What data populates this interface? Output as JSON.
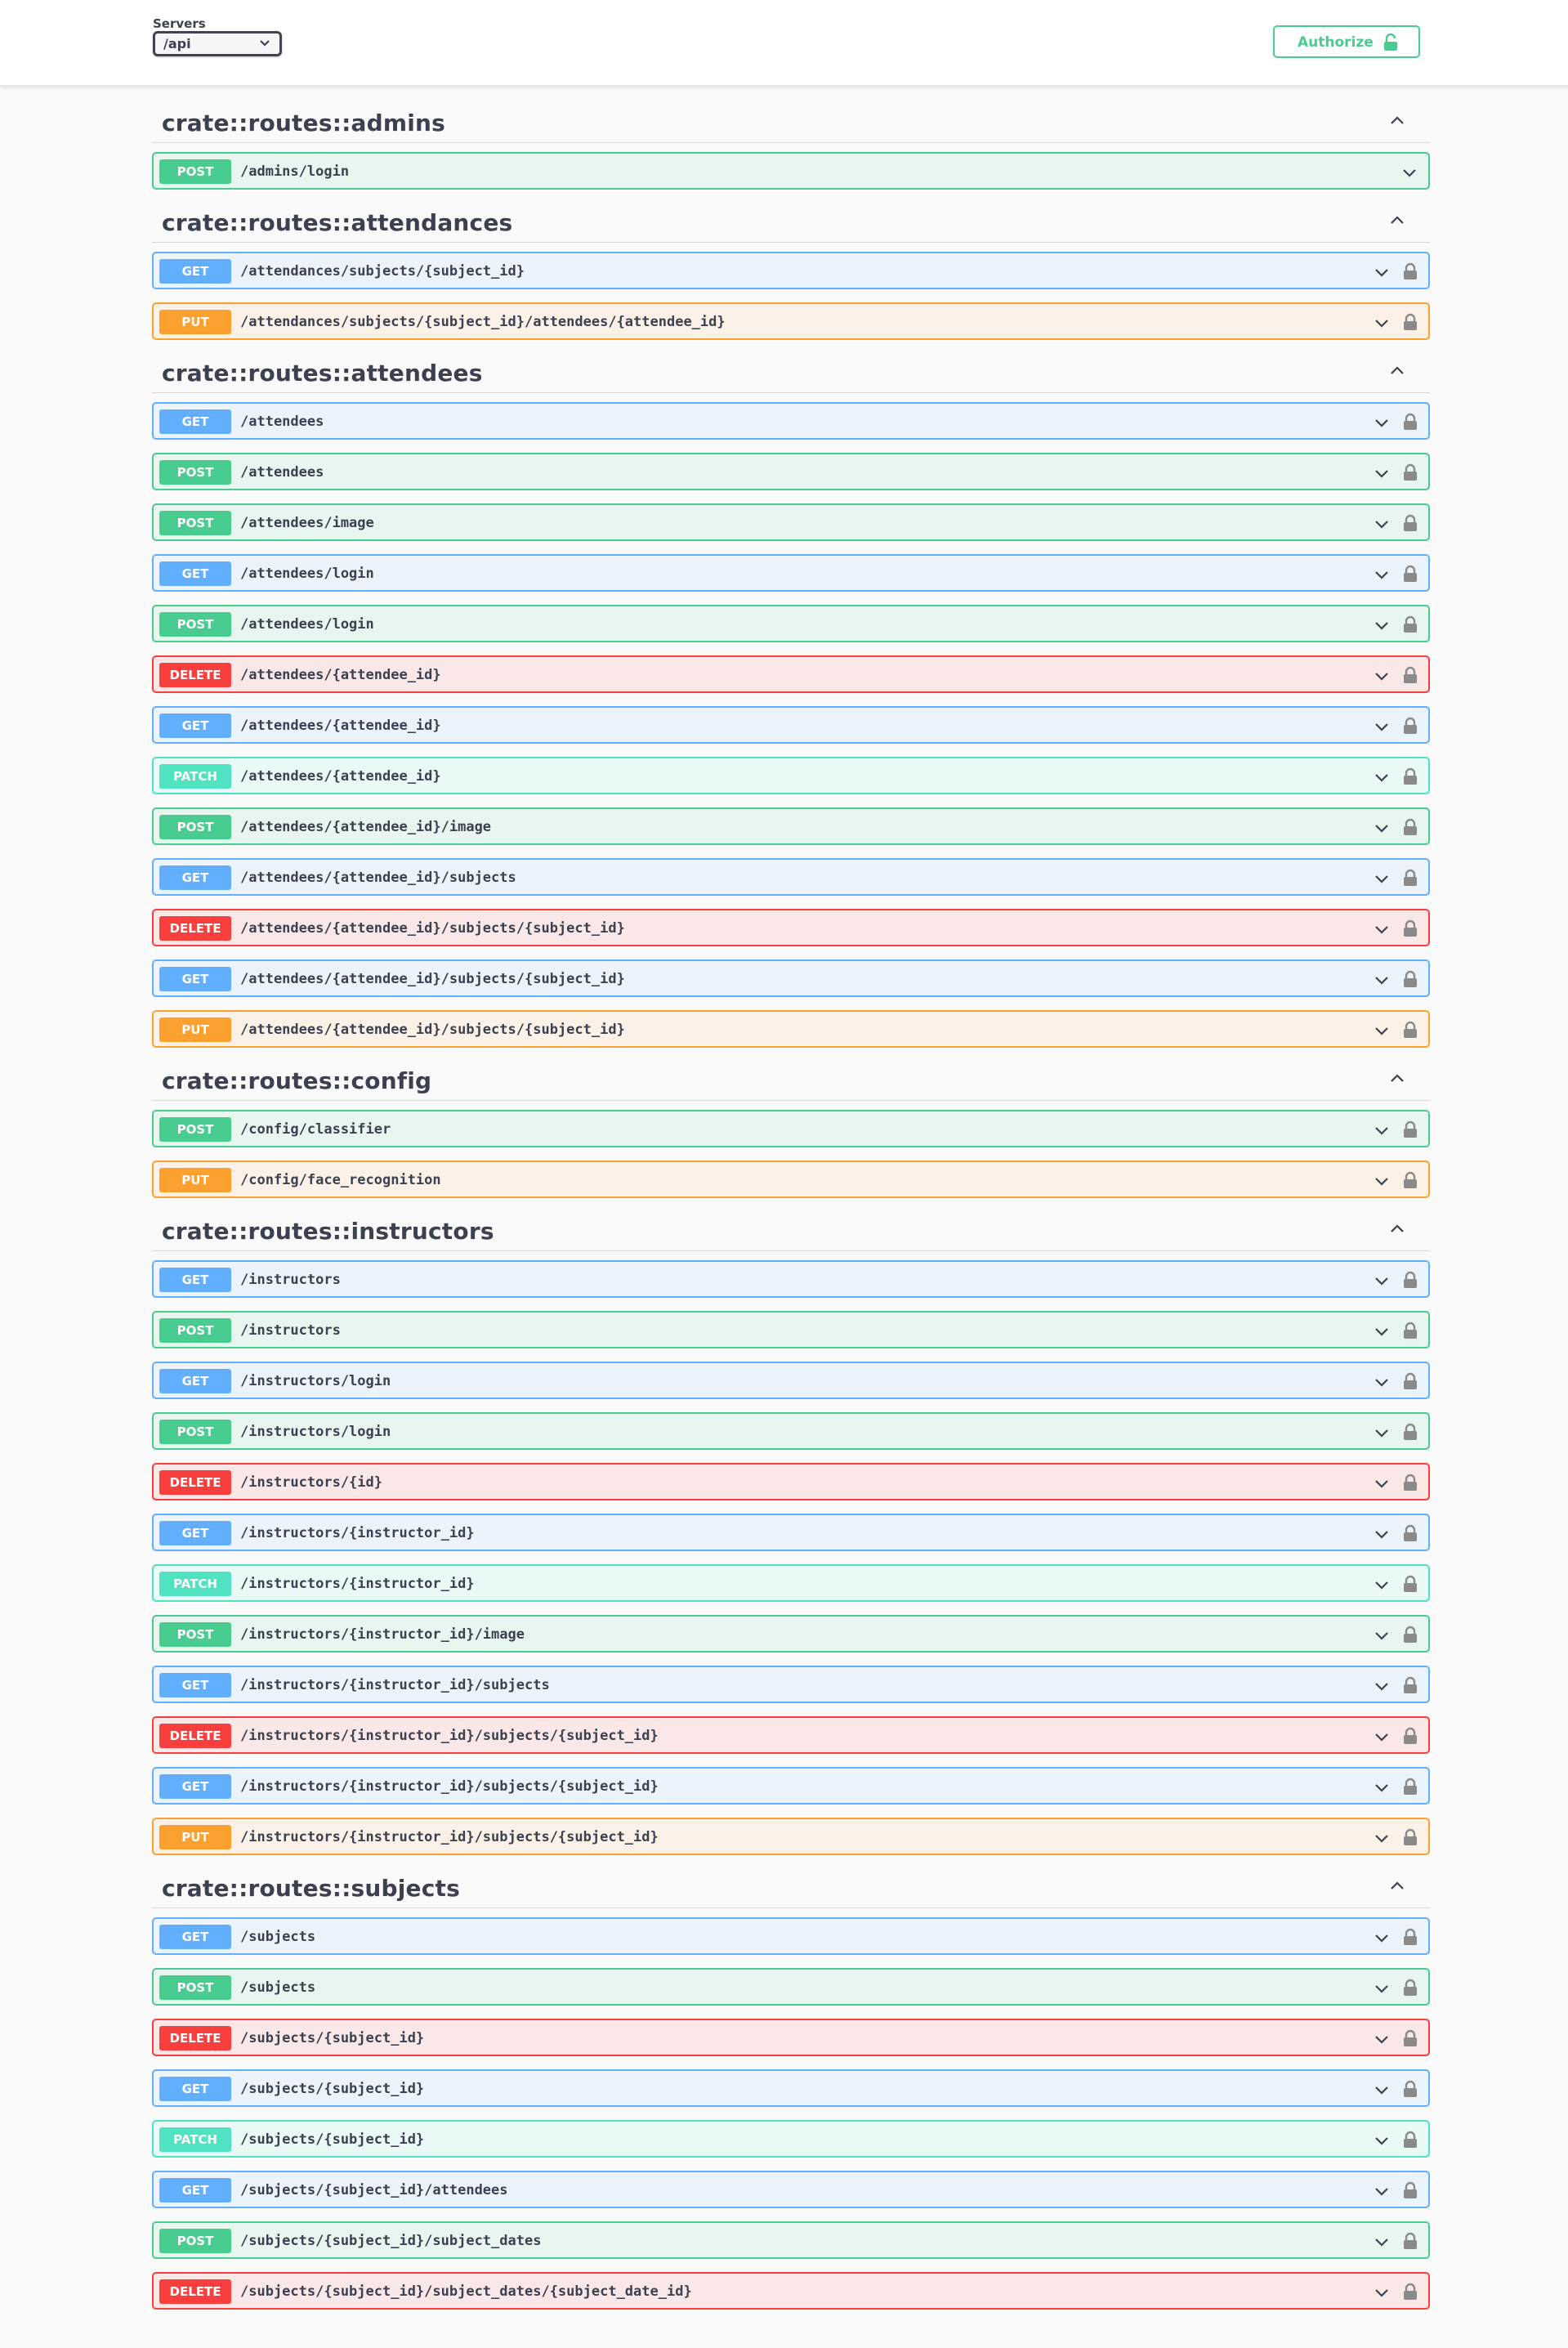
{
  "servers": {
    "label": "Servers",
    "selected": "/api"
  },
  "authorize": {
    "label": "Authorize"
  },
  "colors": {
    "get": "#61affe",
    "post": "#49cc90",
    "put": "#fca130",
    "delete": "#f93e3e",
    "patch": "#50e3c2"
  },
  "tags": [
    {
      "name": "crate::routes::admins",
      "operations": [
        {
          "method": "POST",
          "path": "/admins/login",
          "locked": false
        }
      ]
    },
    {
      "name": "crate::routes::attendances",
      "operations": [
        {
          "method": "GET",
          "path": "/attendances/subjects/{subject_id}",
          "locked": true
        },
        {
          "method": "PUT",
          "path": "/attendances/subjects/{subject_id}/attendees/{attendee_id}",
          "locked": true
        }
      ]
    },
    {
      "name": "crate::routes::attendees",
      "operations": [
        {
          "method": "GET",
          "path": "/attendees",
          "locked": true
        },
        {
          "method": "POST",
          "path": "/attendees",
          "locked": true
        },
        {
          "method": "POST",
          "path": "/attendees/image",
          "locked": true
        },
        {
          "method": "GET",
          "path": "/attendees/login",
          "locked": true
        },
        {
          "method": "POST",
          "path": "/attendees/login",
          "locked": true
        },
        {
          "method": "DELETE",
          "path": "/attendees/{attendee_id}",
          "locked": true
        },
        {
          "method": "GET",
          "path": "/attendees/{attendee_id}",
          "locked": true
        },
        {
          "method": "PATCH",
          "path": "/attendees/{attendee_id}",
          "locked": true
        },
        {
          "method": "POST",
          "path": "/attendees/{attendee_id}/image",
          "locked": true
        },
        {
          "method": "GET",
          "path": "/attendees/{attendee_id}/subjects",
          "locked": true
        },
        {
          "method": "DELETE",
          "path": "/attendees/{attendee_id}/subjects/{subject_id}",
          "locked": true
        },
        {
          "method": "GET",
          "path": "/attendees/{attendee_id}/subjects/{subject_id}",
          "locked": true
        },
        {
          "method": "PUT",
          "path": "/attendees/{attendee_id}/subjects/{subject_id}",
          "locked": true
        }
      ]
    },
    {
      "name": "crate::routes::config",
      "operations": [
        {
          "method": "POST",
          "path": "/config/classifier",
          "locked": true
        },
        {
          "method": "PUT",
          "path": "/config/face_recognition",
          "locked": true
        }
      ]
    },
    {
      "name": "crate::routes::instructors",
      "operations": [
        {
          "method": "GET",
          "path": "/instructors",
          "locked": true
        },
        {
          "method": "POST",
          "path": "/instructors",
          "locked": true
        },
        {
          "method": "GET",
          "path": "/instructors/login",
          "locked": true
        },
        {
          "method": "POST",
          "path": "/instructors/login",
          "locked": true
        },
        {
          "method": "DELETE",
          "path": "/instructors/{id}",
          "locked": true
        },
        {
          "method": "GET",
          "path": "/instructors/{instructor_id}",
          "locked": true
        },
        {
          "method": "PATCH",
          "path": "/instructors/{instructor_id}",
          "locked": true
        },
        {
          "method": "POST",
          "path": "/instructors/{instructor_id}/image",
          "locked": true
        },
        {
          "method": "GET",
          "path": "/instructors/{instructor_id}/subjects",
          "locked": true
        },
        {
          "method": "DELETE",
          "path": "/instructors/{instructor_id}/subjects/{subject_id}",
          "locked": true
        },
        {
          "method": "GET",
          "path": "/instructors/{instructor_id}/subjects/{subject_id}",
          "locked": true
        },
        {
          "method": "PUT",
          "path": "/instructors/{instructor_id}/subjects/{subject_id}",
          "locked": true
        }
      ]
    },
    {
      "name": "crate::routes::subjects",
      "operations": [
        {
          "method": "GET",
          "path": "/subjects",
          "locked": true
        },
        {
          "method": "POST",
          "path": "/subjects",
          "locked": true
        },
        {
          "method": "DELETE",
          "path": "/subjects/{subject_id}",
          "locked": true
        },
        {
          "method": "GET",
          "path": "/subjects/{subject_id}",
          "locked": true
        },
        {
          "method": "PATCH",
          "path": "/subjects/{subject_id}",
          "locked": true
        },
        {
          "method": "GET",
          "path": "/subjects/{subject_id}/attendees",
          "locked": true
        },
        {
          "method": "POST",
          "path": "/subjects/{subject_id}/subject_dates",
          "locked": true
        },
        {
          "method": "DELETE",
          "path": "/subjects/{subject_id}/subject_dates/{subject_date_id}",
          "locked": true
        }
      ]
    }
  ]
}
